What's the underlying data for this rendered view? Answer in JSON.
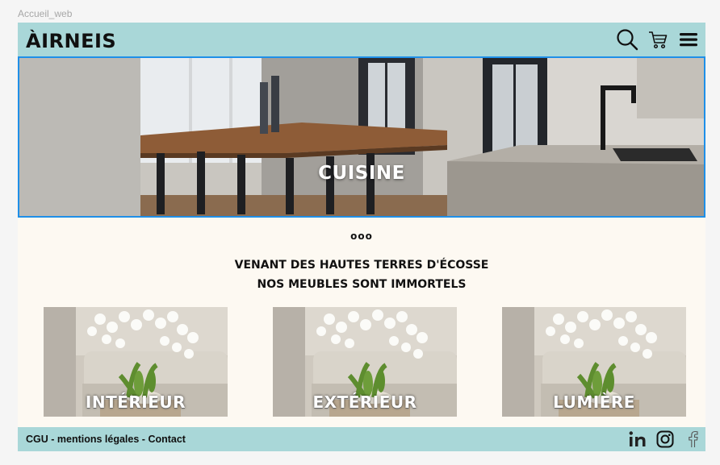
{
  "frame": {
    "label": "Accueil_web"
  },
  "header": {
    "logo": "ÀIRNEIS",
    "icons": [
      "search-icon",
      "cart-icon",
      "menu-icon"
    ]
  },
  "hero": {
    "title": "CUISINE"
  },
  "carousel": {
    "indicator": "ooo"
  },
  "tagline": {
    "line1": "VENANT DES HAUTES TERRES D'ÉCOSSE",
    "line2": "NOS MEUBLES SONT IMMORTELS"
  },
  "categories": [
    {
      "label": "INTÉRIEUR"
    },
    {
      "label": "EXTÉRIEUR"
    },
    {
      "label": "LUMIÈRE"
    }
  ],
  "footer": {
    "cgu": "CGU",
    "legal": "mentions légales",
    "contact": "Contact",
    "separator": " - ",
    "social": [
      "linkedin-icon",
      "instagram-icon",
      "facebook-icon"
    ]
  },
  "colors": {
    "header_bg": "#a9d7d8",
    "page_bg": "#fdf9f2",
    "selection_border": "#1e8fe8"
  }
}
